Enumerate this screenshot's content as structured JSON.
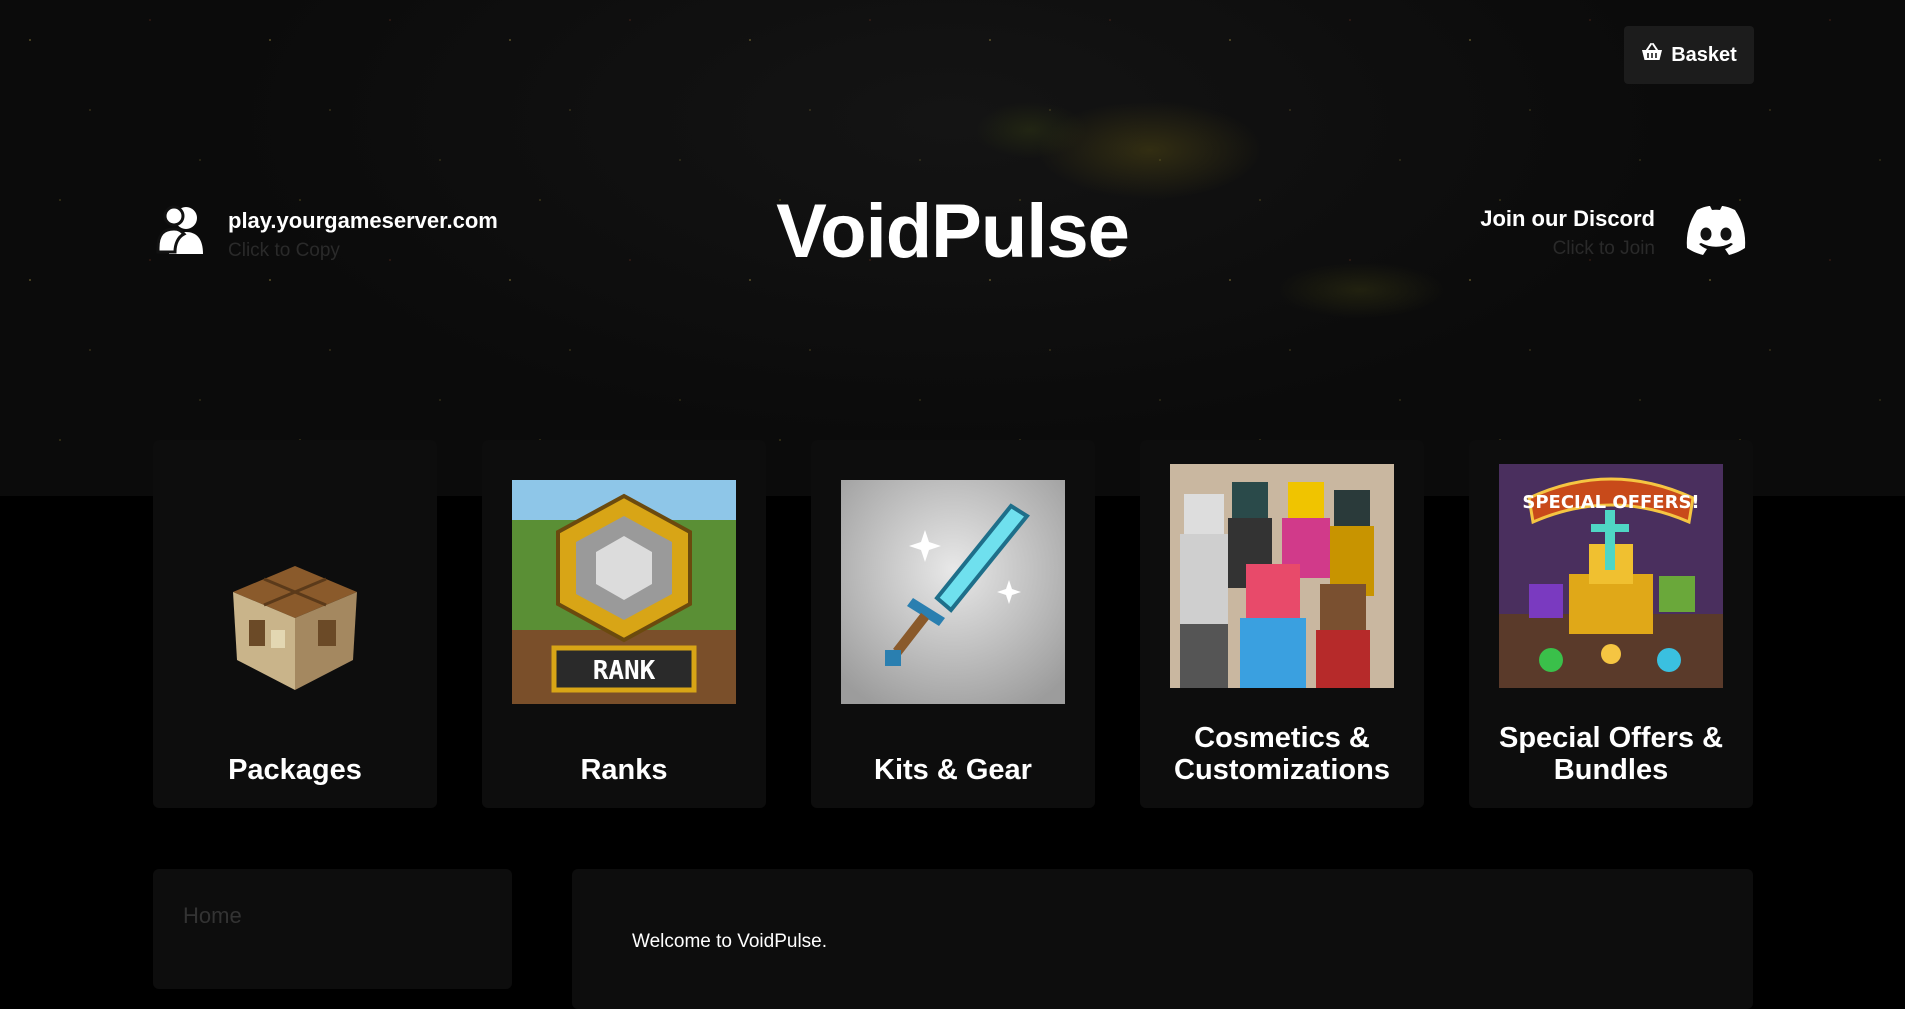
{
  "header": {
    "basket_label": "Basket",
    "server_ip": "play.yourgameserver.com",
    "server_ip_hint": "Click to Copy",
    "store_name": "VoidPulse",
    "discord_label": "Join our Discord",
    "discord_hint": "Click to Join"
  },
  "categories": [
    {
      "title": "Packages",
      "icon": "crafting-table-image"
    },
    {
      "title": "Ranks",
      "icon": "rank-badge-image"
    },
    {
      "title": "Kits & Gear",
      "icon": "diamond-sword-image"
    },
    {
      "title": "Cosmetics & Customizations",
      "icon": "cosmetic-skins-image"
    },
    {
      "title": "Special Offers & Bundles",
      "icon": "special-offers-image"
    }
  ],
  "sidebar": {
    "home_label": "Home"
  },
  "main": {
    "welcome_text": "Welcome to VoidPulse."
  }
}
